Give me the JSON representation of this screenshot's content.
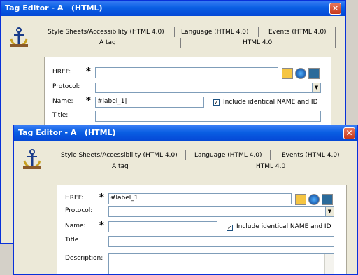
{
  "back": {
    "title": "Tag Editor - A   (HTML)",
    "tabs": [
      "Style Sheets/Accessibility (HTML 4.0)",
      "Language (HTML 4.0)",
      "Events (HTML 4.0)"
    ],
    "subtabs": [
      "A tag",
      "HTML 4.0"
    ],
    "href_label": "HREF:",
    "protocol_label": "Protocol:",
    "name_label": "Name:",
    "name_value": "#label_1|",
    "include_label": "Include identical NAME and ID",
    "title_label": "Title:"
  },
  "front": {
    "title": "Tag Editor - A   (HTML)",
    "tabs": [
      "Style Sheets/Accessibility (HTML 4.0)",
      "Language (HTML 4.0)",
      "Events (HTML 4.0)"
    ],
    "subtabs": [
      "A tag",
      "HTML 4.0"
    ],
    "href_label": "HREF:",
    "href_value": "#label_1",
    "protocol_label": "Protocol:",
    "name_label": "Name:",
    "name_value": "",
    "include_label": "Include identical NAME and ID",
    "title_label": "Title",
    "description_label": "Description:"
  },
  "icons": [
    "anchor-icon",
    "folder-open-icon",
    "globe-icon",
    "image-icon",
    "checkbox-checked-icon",
    "close-icon"
  ],
  "colors": {
    "titlebar": "#0a5fe3",
    "close": "#c6381c",
    "dialog": "#ece9d8"
  }
}
